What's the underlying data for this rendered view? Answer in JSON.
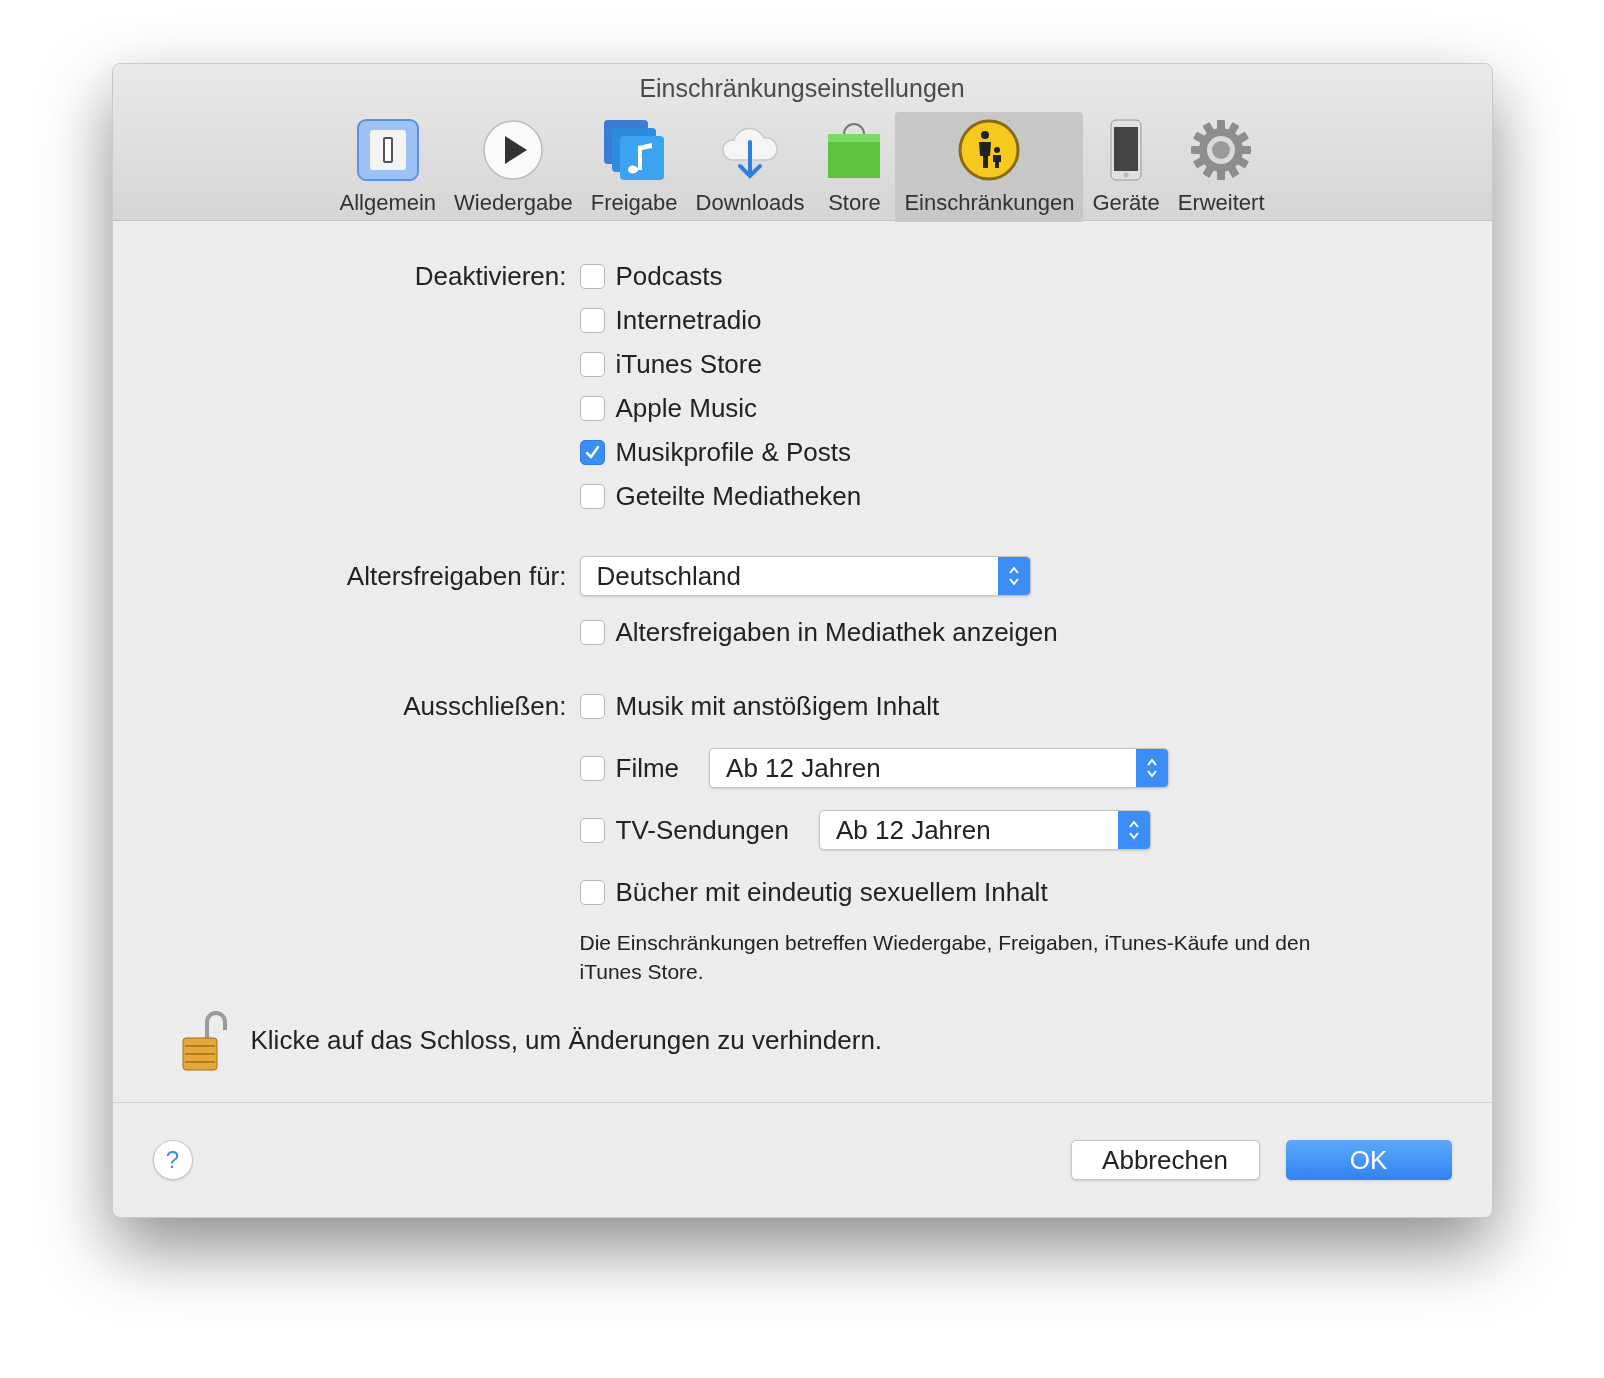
{
  "window": {
    "title": "Einschränkungseinstellungen"
  },
  "toolbar": [
    {
      "label": "Allgemein",
      "selected": false
    },
    {
      "label": "Wiedergabe",
      "selected": false
    },
    {
      "label": "Freigabe",
      "selected": false
    },
    {
      "label": "Downloads",
      "selected": false
    },
    {
      "label": "Store",
      "selected": false
    },
    {
      "label": "Einschränkungen",
      "selected": true
    },
    {
      "label": "Geräte",
      "selected": false
    },
    {
      "label": "Erweitert",
      "selected": false
    }
  ],
  "deactivate": {
    "label": "Deaktivieren:",
    "options": [
      {
        "label": "Podcasts",
        "checked": false
      },
      {
        "label": "Internetradio",
        "checked": false
      },
      {
        "label": "iTunes Store",
        "checked": false
      },
      {
        "label": "Apple Music",
        "checked": false
      },
      {
        "label": "Musikprofile & Posts",
        "checked": true
      },
      {
        "label": "Geteilte Mediatheken",
        "checked": false
      }
    ]
  },
  "ratings": {
    "label": "Altersfreigaben für:",
    "value": "Deutschland",
    "option": {
      "label": "Altersfreigaben in Mediathek anzeigen",
      "checked": false
    }
  },
  "exclude": {
    "label": "Ausschließen:",
    "items": [
      {
        "kind": "checkbox",
        "label": "Musik mit anstößigem Inhalt",
        "checked": false
      },
      {
        "kind": "select",
        "label": "Filme",
        "checked": false,
        "value": "Ab 12 Jahren"
      },
      {
        "kind": "select",
        "label": "TV-Sendungen",
        "checked": false,
        "value": "Ab 12 Jahren"
      },
      {
        "kind": "checkbox",
        "label": "Bücher mit eindeutig sexuellem Inhalt",
        "checked": false
      }
    ]
  },
  "note": "Die Einschränkungen betreffen Wiedergabe, Freigaben, iTunes-Käufe und den iTunes Store.",
  "lock_hint": "Klicke auf das Schloss, um Änderungen zu verhindern.",
  "buttons": {
    "help": "?",
    "cancel": "Abbrechen",
    "ok": "OK"
  }
}
